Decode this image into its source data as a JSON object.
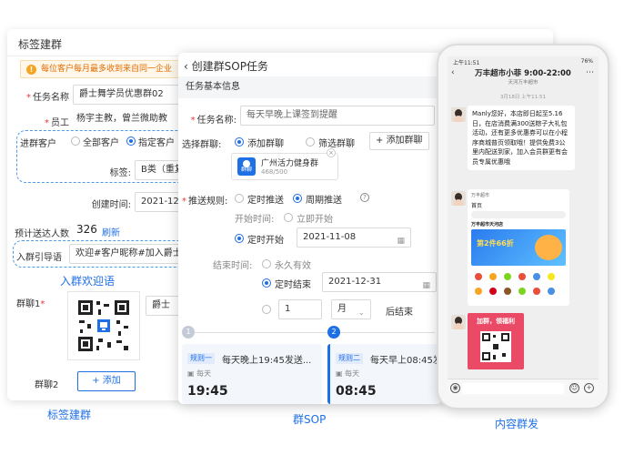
{
  "panel1": {
    "title": "标签建群",
    "warning": "每位客户每月最多收到来自同一企业",
    "task_name_label": "任务名称",
    "task_name_value": "爵士舞学员优惠群02",
    "employee_label": "员工",
    "employee_value": "杨宇主教，曾兰微助教",
    "target_label": "进群客户",
    "target_options": [
      "全部客户",
      "指定客户"
    ],
    "target_selected": "指定客户",
    "tag_label": "标签:",
    "tag_value": "B类（重复",
    "created_label": "创建时间:",
    "created_value": "2021-12-",
    "estimate_label": "预计送达人数",
    "estimate_value": "326",
    "refresh_label": "刷新",
    "guide_label": "入群引导语",
    "guide_value": "欢迎#客户昵称#加入爵士",
    "guide_callout": "入群欢迎语",
    "group1_label": "群聊1",
    "group1_name": "爵士",
    "group2_label": "群聊2",
    "add_label": "添加"
  },
  "panel2": {
    "title": "创建群SOP任务",
    "section": "任务基本信息",
    "task_name_label": "任务名称:",
    "task_name_value": "每天早晚上课签到提醒",
    "group_label": "选择群聊:",
    "group_options": [
      "添加群聊",
      "筛选群聊"
    ],
    "add_group_button": "添加群聊",
    "group_card_name": "广州活力健身群",
    "group_card_count": "468/500",
    "group_card_icon_text": "群聊",
    "push_label": "推送规则:",
    "push_options": [
      "定时推送",
      "周期推送"
    ],
    "start_label": "开始时间:",
    "start_options": [
      "立即开始",
      "定时开始"
    ],
    "start_date": "2021-11-08",
    "end_label": "结束时间:",
    "end_options": [
      "永久有效",
      "定时结束"
    ],
    "end_date": "2021-12-31",
    "interval_value": "1",
    "interval_unit": "月",
    "after_label": "后结束",
    "steps": [
      "1",
      "2"
    ],
    "rules": [
      {
        "tag": "规则一",
        "title": "每天晚上19:45发送...",
        "freq": "每天",
        "time": "19:45"
      },
      {
        "tag": "规则二",
        "title": "每天早上08:45发送",
        "freq": "每天",
        "time": "08:45"
      }
    ]
  },
  "phone": {
    "status_time": "上午11:51",
    "status_right": "76%",
    "chat_title": "万丰超市小菲 9:00-22:00",
    "chat_subtitle": "天河万丰超市",
    "date": "3月18日 上午11:51",
    "message": "Manly您好，本店即日起至5.16日，在店消费满300送粽子大礼包活动，还有更多优惠券可以在小程序商城普页领取哦！提供免费3公里内配送到家，加入会员群更有会员专属优惠哦",
    "mini_app_brand": "万丰超市",
    "mini_app_home": "首页",
    "mini_app_store": "万丰超市天河店",
    "mini_app_banner": "第2件66折",
    "poster_text": "加群，领福利"
  },
  "captions": {
    "left": "标签建群",
    "middle": "群SOP",
    "right": "内容群发"
  },
  "colors": {
    "accent": "#1f6fe5",
    "warning": "#e06a00",
    "required": "#e4393c"
  }
}
